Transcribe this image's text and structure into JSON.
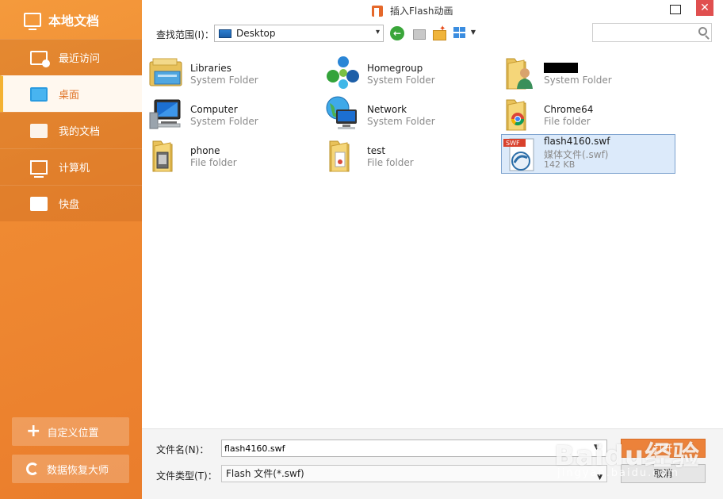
{
  "sidebar": {
    "title": "本地文档",
    "items": [
      {
        "label": "最近访问",
        "icon": "recent-icon"
      },
      {
        "label": "桌面",
        "icon": "desktop-icon",
        "active": true
      },
      {
        "label": "我的文档",
        "icon": "folder-icon"
      },
      {
        "label": "计算机",
        "icon": "computer-icon"
      },
      {
        "label": "快盘",
        "icon": "cloud-drive-icon"
      }
    ],
    "custom_location_label": "自定义位置",
    "recovery_label": "数据恢复大师"
  },
  "titlebar": {
    "title": "插入Flash动画",
    "minimize_glyph": "□",
    "close_glyph": "✕"
  },
  "toolbar": {
    "lookin_label": "查找范围(I)：",
    "lookin_value": "Desktop",
    "search_placeholder": ""
  },
  "files": [
    {
      "name": "Libraries",
      "type": "System Folder",
      "icon": "libraries-icon"
    },
    {
      "name": "Homegroup",
      "type": "System Folder",
      "icon": "homegroup-icon"
    },
    {
      "name": "",
      "type": "System Folder",
      "icon": "user-folder-icon",
      "redacted": true
    },
    {
      "name": "Computer",
      "type": "System Folder",
      "icon": "computer-icon"
    },
    {
      "name": "Network",
      "type": "System Folder",
      "icon": "network-icon"
    },
    {
      "name": "Chrome64",
      "type": "File folder",
      "icon": "folder-icon"
    },
    {
      "name": "phone",
      "type": "File folder",
      "icon": "folder-icon"
    },
    {
      "name": "test",
      "type": "File folder",
      "icon": "folder-icon"
    },
    {
      "name": "flash4160.swf",
      "type": "媒体文件(.swf)",
      "size": "142 KB",
      "icon": "swf-file-icon",
      "selected": true
    }
  ],
  "bottom": {
    "filename_label": "文件名(N)：",
    "filename_value": "flash4160.swf",
    "filetype_label": "文件类型(T)：",
    "filetype_value": "Flash 文件(*.swf)",
    "open_label": "打开",
    "cancel_label": "取消"
  },
  "watermark": {
    "text": "Baidu经验",
    "sub": "jingyan.baidu.com"
  },
  "colors": {
    "accent": "#ec823a",
    "sidebar": "#ef8a32",
    "close": "#e04f4f",
    "selection": "#dceafa"
  }
}
